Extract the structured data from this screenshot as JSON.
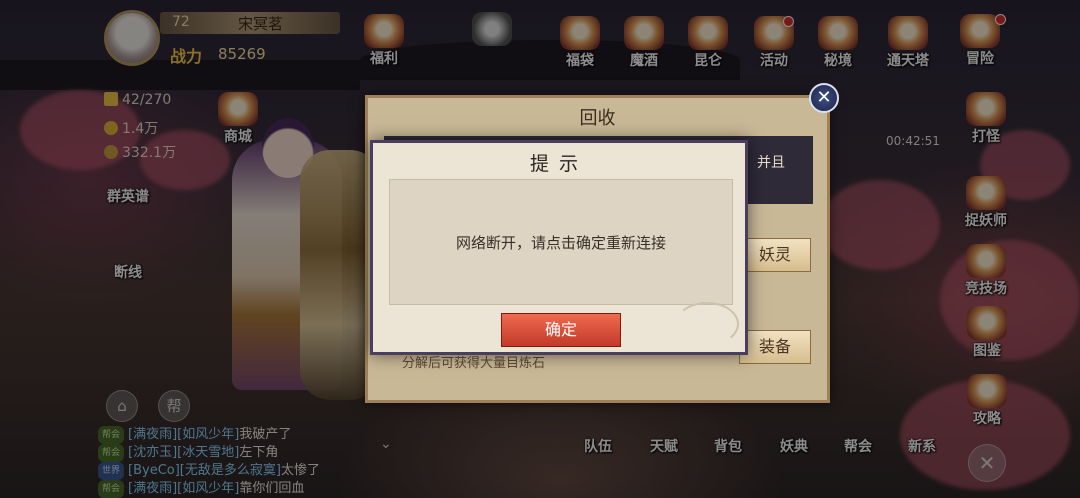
{
  "player": {
    "level": "72",
    "name": "宋冥茗",
    "power_label": "战力",
    "power_value": "85269"
  },
  "resources": [
    {
      "icon": "lightning-icon",
      "value": "42/270"
    },
    {
      "icon": "gold-coin-icon",
      "value": "1.4万"
    },
    {
      "icon": "ingot-icon",
      "value": "332.1万"
    }
  ],
  "top_menu": [
    {
      "name": "welfare",
      "label": "福利"
    },
    {
      "name": "blessing",
      "label": "福袋"
    },
    {
      "name": "carnival",
      "label": "魔酒"
    },
    {
      "name": "kunlun",
      "label": "昆仑"
    },
    {
      "name": "events",
      "label": "活动"
    },
    {
      "name": "secret-realm",
      "label": "秘境"
    },
    {
      "name": "tongtian-tower",
      "label": "通天塔"
    },
    {
      "name": "adventure",
      "label": "冒险"
    }
  ],
  "left_menu": [
    {
      "name": "shop",
      "label": "商城"
    },
    {
      "name": "handbook",
      "label": "群英谱"
    },
    {
      "name": "disconnect",
      "label": "断线"
    }
  ],
  "right_menu": [
    {
      "name": "hunt",
      "label": "打怪"
    },
    {
      "name": "demon-catcher",
      "label": "捉妖师"
    },
    {
      "name": "arena",
      "label": "竞技场"
    },
    {
      "name": "atlas",
      "label": "图鉴"
    },
    {
      "name": "guide",
      "label": "攻略"
    }
  ],
  "bottom_menu": [
    {
      "name": "team",
      "label": "队伍"
    },
    {
      "name": "destiny",
      "label": "天赋"
    },
    {
      "name": "bag",
      "label": "背包"
    },
    {
      "name": "monster-book",
      "label": "妖典"
    },
    {
      "name": "guild",
      "label": "帮会"
    },
    {
      "name": "new-features",
      "label": "新系"
    }
  ],
  "timer": "00:42:51",
  "recycle_panel": {
    "title": "回收",
    "strip_text": "并且",
    "btn_spirit": "妖灵",
    "btn_equipment": "装备",
    "note": "分解后可获得大量目炼石"
  },
  "dialog": {
    "title": "提示",
    "message": "网络断开，请点击确定重新连接",
    "ok_label": "确定"
  },
  "chat_buttons": {
    "help": "帮"
  },
  "chat": [
    {
      "channel": "帮会",
      "channel_type": "family",
      "sender": "[满夜雨][如风少年]",
      "text": "我破产了"
    },
    {
      "channel": "帮会",
      "channel_type": "family",
      "sender": "[沈亦玉][冰天雪地]",
      "text": "左下角"
    },
    {
      "channel": "世界",
      "channel_type": "world",
      "sender": "[ByeCo][无敌是多么寂寞]",
      "text": "太惨了"
    },
    {
      "channel": "帮会",
      "channel_type": "family",
      "sender": "[满夜雨][如风少年]",
      "text": "靠你们回血"
    }
  ]
}
